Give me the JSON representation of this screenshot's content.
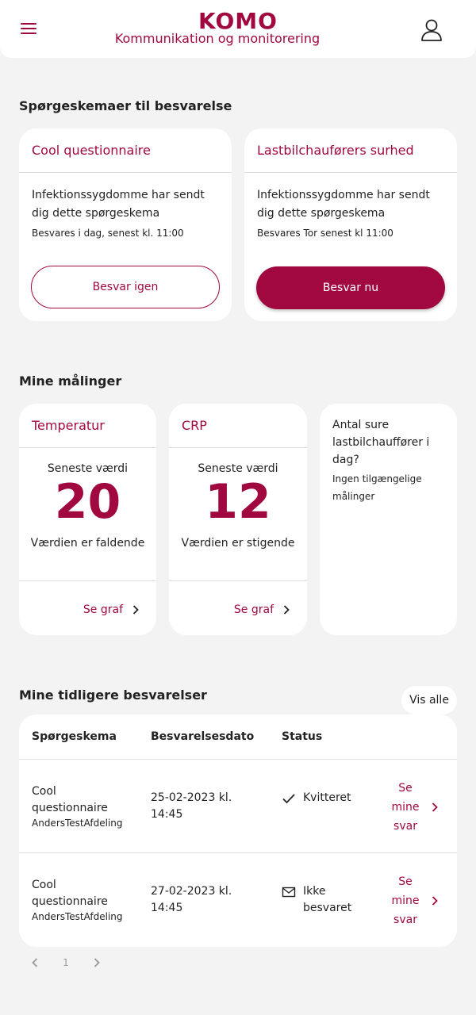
{
  "header": {
    "logo": "KOMO",
    "tagline": "Kommunikation og monitorering",
    "menu_icon": "hamburger-menu-icon",
    "profile_icon": "user-profile-icon"
  },
  "questionnaires": {
    "title": "Spørgeskemaer til besvarelse",
    "items": [
      {
        "name": "Cool questionnaire",
        "description": "Infektionssygdomme har sendt dig dette spørgeskema",
        "deadline": "Besvares i dag, senest kl. 11:00",
        "button": "Besvar igen"
      },
      {
        "name": "Lastbilchauførers surhed",
        "description": "Infektionssygdomme har sendt dig dette spørgeskema",
        "deadline": "Besvares Tor senest kl 11:00",
        "button": "Besvar nu"
      }
    ]
  },
  "measurements": {
    "title": "Mine målinger",
    "items": [
      {
        "name": "Temperatur",
        "label": "Seneste værdi",
        "value": "20",
        "trend": "Værdien er faldende",
        "link": "Se graf"
      },
      {
        "name": "CRP",
        "label": "Seneste værdi",
        "value": "12",
        "trend": "Værdien er stigende",
        "link": "Se graf"
      }
    ],
    "empty": {
      "question": "Antal sure lastbilchauffører i dag?",
      "note": "Ingen tilgængelige målinger"
    }
  },
  "history": {
    "title": "Mine tidligere besvarelser",
    "show_all": "Vis alle",
    "columns": [
      "Spørgeskema",
      "Besvarelsesdato",
      "Status"
    ],
    "rows": [
      {
        "questionnaire": "Cool questionnaire",
        "department": "AndersTestAfdeling",
        "date": "25-02-2023 kl. 14:45",
        "status": "Kvitteret",
        "status_icon": "checkmark-icon",
        "link": "Se mine svar"
      },
      {
        "questionnaire": "Cool questionnaire",
        "department": "AndersTestAfdeling",
        "date": "27-02-2023 kl. 14:45",
        "status": "Ikke besvaret",
        "status_icon": "envelope-icon",
        "link": "Se mine svar"
      }
    ]
  },
  "pagination": {
    "current_page": "1"
  },
  "colors": {
    "brand": "#a0083f",
    "background": "#f3f3f3",
    "card": "#ffffff"
  }
}
